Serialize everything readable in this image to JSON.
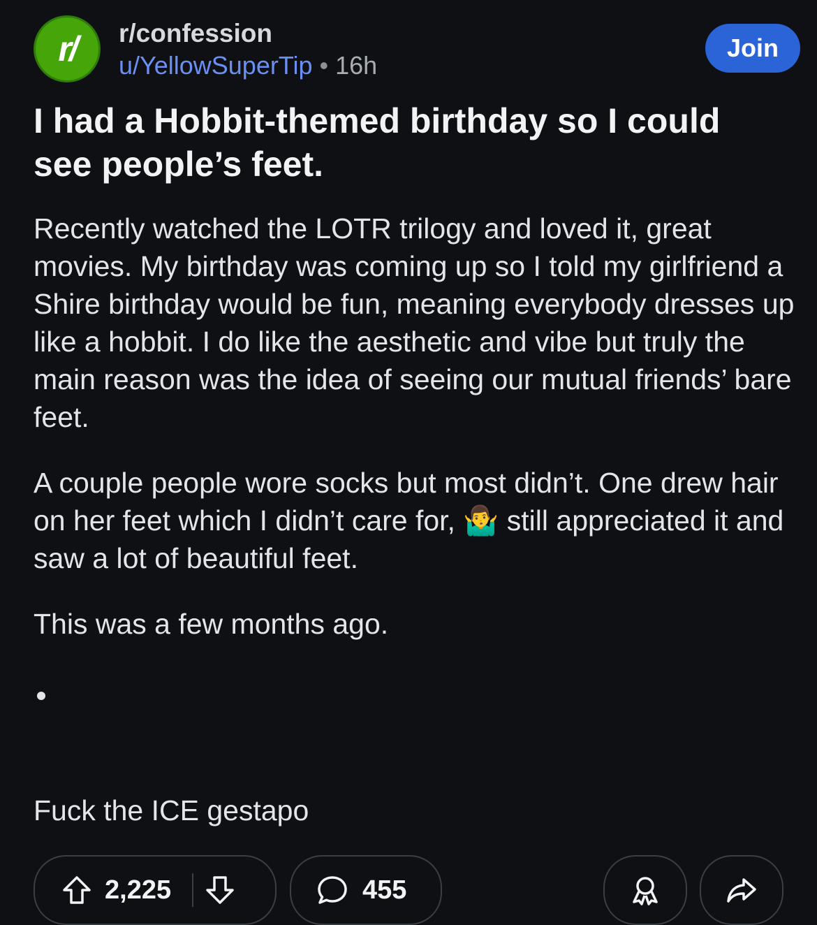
{
  "header": {
    "subreddit": "r/confession",
    "author": "u/YellowSuperTip",
    "separator": "•",
    "time_ago": "16h",
    "avatar_text": "r/",
    "join_label": "Join",
    "colors": {
      "avatar": "#46a508",
      "author": "#6b8ff2",
      "join_button": "#2a64d6"
    }
  },
  "post": {
    "title": "I had a Hobbit-themed birthday so I could see people’s feet.",
    "paragraphs": [
      "Recently watched the LOTR trilogy and loved it, great movies. My birthday was coming up so I told my girlfriend a Shire birthday would be fun, meaning everybody dresses up like a hobbit. I do like the aesthetic and vibe but truly the main reason was the idea of seeing our mutual friends’ bare feet.",
      "A couple people wore socks but most didn’t. One drew hair on her feet which I didn’t care for, 🤷‍♂️ still appreciated it and saw a lot of beautiful feet.",
      "This was a few months ago.",
      "Fuck the ICE gestapo"
    ]
  },
  "actions": {
    "upvotes": "2,225",
    "comments": "455",
    "icons": {
      "upvote": "upvote-arrow-icon",
      "downvote": "downvote-arrow-icon",
      "comment": "comment-bubble-icon",
      "award": "award-ribbon-icon",
      "share": "share-arrow-icon"
    }
  }
}
